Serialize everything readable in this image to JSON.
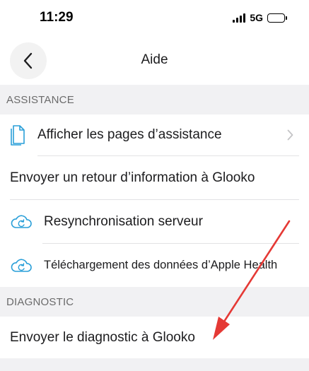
{
  "status_bar": {
    "time": "11:29",
    "network": "5G"
  },
  "nav": {
    "title": "Aide"
  },
  "sections": {
    "assistance": {
      "header": "ASSISTANCE"
    },
    "diagnostic": {
      "header": "DIAGNOSTIC"
    }
  },
  "rows": {
    "help_pages": "Afficher les pages d’assistance",
    "feedback": "Envoyer un retour d’information à Glooko",
    "resync": "Resynchronisation serveur",
    "apple_health": "Téléchargement des données d’Apple Health",
    "send_diagnostic": "Envoyer le diagnostic à Glooko"
  },
  "colors": {
    "accent": "#2a9fd8",
    "annotation_arrow": "#e53935",
    "section_bg": "#f1f1f3"
  },
  "icons": {
    "back": "chevron-left-icon",
    "help_pages": "document-icon",
    "resync": "cloud-sync-icon",
    "apple_health": "cloud-sync-icon",
    "disclosure": "chevron-right-icon"
  }
}
